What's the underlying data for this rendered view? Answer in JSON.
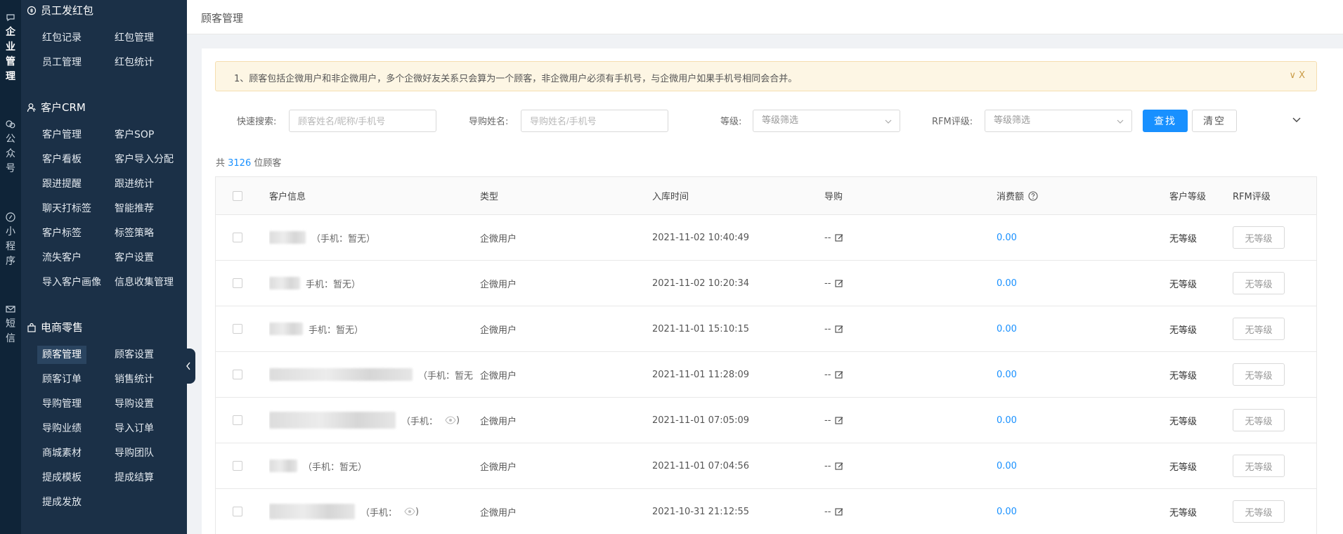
{
  "rail": [
    {
      "label": "企业管理",
      "icon": "chat-bubble-icon",
      "active": true
    },
    {
      "label": "公众号",
      "icon": "wechat-icon",
      "active": false
    },
    {
      "label": "小程序",
      "icon": "miniprogram-icon",
      "active": false
    },
    {
      "label": "短信",
      "icon": "mail-icon",
      "active": false
    }
  ],
  "sidebar": {
    "groups": [
      {
        "title": "员工发红包",
        "icon": "red-packet-icon",
        "items": [
          "红包记录",
          "红包管理",
          "员工管理",
          "红包统计"
        ]
      },
      {
        "title": "客户CRM",
        "icon": "crm-user-icon",
        "items": [
          "客户管理",
          "客户SOP",
          "客户看板",
          "客户导入分配",
          "跟进提醒",
          "跟进统计",
          "聊天打标签",
          "智能推荐",
          "客户标签",
          "标签策略",
          "流失客户",
          "客户设置",
          "导入客户画像",
          "信息收集管理"
        ]
      },
      {
        "title": "电商零售",
        "icon": "shop-bag-icon",
        "items": [
          "顾客管理",
          "顾客设置",
          "顾客订单",
          "销售统计",
          "导购管理",
          "导购设置",
          "导购业绩",
          "导入订单",
          "商城素材",
          "导购团队",
          "提成模板",
          "提成结算",
          "提成发放"
        ]
      }
    ],
    "active_item": "顾客管理"
  },
  "header": {
    "title": "顾客管理"
  },
  "notice": {
    "text": "1、顾客包括企微用户和非企微用户，多个企微好友关系只会算为一个顾客，非企微用户必须有手机号，与企微用户如果手机号相同会合并。",
    "controls": "∨ X"
  },
  "filters": {
    "quick_search_label": "快速搜索:",
    "quick_search_placeholder": "顾客姓名/昵称/手机号",
    "guide_label": "导购姓名:",
    "guide_placeholder": "导购姓名/手机号",
    "level_label": "等级:",
    "level_value": "等级筛选",
    "rfm_label": "RFM评级:",
    "rfm_value": "等级筛选",
    "search_button": "查找",
    "clear_button": "清空"
  },
  "summary": {
    "prefix": "共 ",
    "count": "3126",
    "suffix": " 位顾客"
  },
  "table": {
    "headers": {
      "info": "客户信息",
      "type": "类型",
      "time": "入库时间",
      "guide": "导购",
      "amount": "消费额",
      "level": "客户等级",
      "rfm": "RFM评级"
    },
    "rows": [
      {
        "phone": "（手机：暂无）",
        "type": "企微用户",
        "time": "2021-11-02 10:40:49",
        "guide": "--",
        "amount": "0.00",
        "level": "无等级",
        "rfm": "无等级"
      },
      {
        "phone": "手机：暂无）",
        "type": "企微用户",
        "time": "2021-11-02 10:20:34",
        "guide": "--",
        "amount": "0.00",
        "level": "无等级",
        "rfm": "无等级"
      },
      {
        "phone": "手机：暂无）",
        "type": "企微用户",
        "time": "2021-11-01 15:10:15",
        "guide": "--",
        "amount": "0.00",
        "level": "无等级",
        "rfm": "无等级"
      },
      {
        "phone": "（手机：暂无",
        "type": "企微用户",
        "time": "2021-11-01 11:28:09",
        "guide": "--",
        "amount": "0.00",
        "level": "无等级",
        "rfm": "无等级"
      },
      {
        "phone": "（手机：",
        "phone_end": ")",
        "type": "企微用户",
        "time": "2021-11-01 07:05:09",
        "guide": "--",
        "amount": "0.00",
        "level": "无等级",
        "rfm": "无等级"
      },
      {
        "phone": "（手机：暂无）",
        "type": "企微用户",
        "time": "2021-11-01 07:04:56",
        "guide": "--",
        "amount": "0.00",
        "level": "无等级",
        "rfm": "无等级"
      },
      {
        "phone": "（手机：",
        "phone_end": ")",
        "type": "企微用户",
        "time": "2021-10-31 21:12:55",
        "guide": "--",
        "amount": "0.00",
        "level": "无等级",
        "rfm": "无等级"
      }
    ]
  },
  "colors": {
    "accent": "#1890ff",
    "sidebar_bg": "#1b3047",
    "rail_bg": "#0f2438",
    "notice_bg": "#fdf6e4"
  }
}
